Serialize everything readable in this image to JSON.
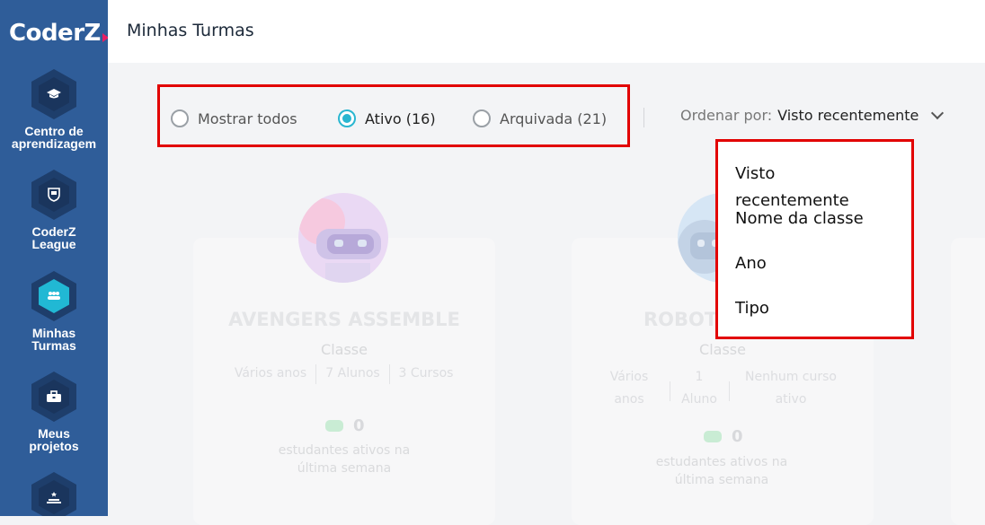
{
  "brand": {
    "logo_text": "CoderZ"
  },
  "sidebar": {
    "items": [
      {
        "label_line1": "Centro de",
        "label_line2": "aprendizagem",
        "icon": "graduation-cap-icon",
        "active": false
      },
      {
        "label_line1": "CoderZ",
        "label_line2": "League",
        "icon": "shield-trophy-icon",
        "active": false
      },
      {
        "label_line1": "Minhas",
        "label_line2": "Turmas",
        "icon": "users-icon",
        "active": true
      },
      {
        "label_line1": "Meus",
        "label_line2": "projetos",
        "icon": "briefcase-icon",
        "active": false
      },
      {
        "icon": "podium-icon",
        "active": false
      }
    ]
  },
  "header": {
    "title": "Minhas Turmas"
  },
  "filters": {
    "options": [
      {
        "label": "Mostrar todos",
        "checked": false
      },
      {
        "label": "Ativo (16)",
        "checked": true
      },
      {
        "label": "Arquivada (21)",
        "checked": false
      }
    ]
  },
  "sort": {
    "label": "Ordenar por:",
    "value": "Visto recentemente",
    "options": [
      "Visto recentemente",
      "Nome da classe",
      "Ano",
      "Tipo"
    ]
  },
  "cards": [
    {
      "title": "AVENGERS ASSEMBLE",
      "type": "Classe",
      "meta": [
        "Vários anos",
        "7 Alunos",
        "3 Cursos"
      ],
      "active_count": "0",
      "active_text": "estudantes ativos na última semana"
    },
    {
      "title": "ROBOT",
      "type": "Classe",
      "meta": [
        "Vários anos",
        "1 Aluno",
        "Nenhum curso ativo"
      ],
      "active_count": "0",
      "active_text": "estudantes ativos na última semana"
    }
  ],
  "colors": {
    "sidebar": "#2f5d99",
    "accent": "#29b6d0",
    "highlight": "#e20000"
  }
}
